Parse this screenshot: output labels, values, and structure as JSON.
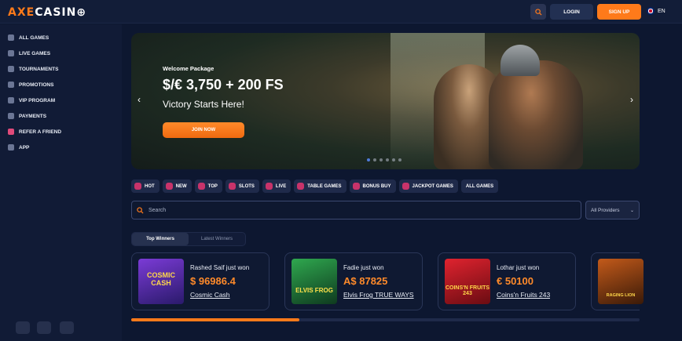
{
  "header": {
    "logo_part1": "AXE",
    "logo_part2": "CASIN⊕",
    "login": "LOGIN",
    "signup": "SIGN UP",
    "lang": "EN"
  },
  "sidebar": {
    "items": [
      {
        "label": "ALL GAMES",
        "icon": "grid-icon"
      },
      {
        "label": "LIVE GAMES",
        "icon": "live-icon"
      },
      {
        "label": "TOURNAMENTS",
        "icon": "trophy-icon"
      },
      {
        "label": "PROMOTIONS",
        "icon": "megaphone-icon"
      },
      {
        "label": "VIP PROGRAM",
        "icon": "crown-icon"
      },
      {
        "label": "PAYMENTS",
        "icon": "wallet-icon"
      },
      {
        "label": "REFER A FRIEND",
        "icon": "friends-icon"
      },
      {
        "label": "APP",
        "icon": "apps-icon"
      }
    ]
  },
  "banner": {
    "welcome": "Welcome Package",
    "amount": "$/€ 3,750 + 200 FS",
    "tagline": "Victory Starts Here!",
    "join": "JOIN NOW",
    "slides": 6,
    "active_slide": 1
  },
  "filters": [
    "HOT",
    "NEW",
    "TOP",
    "SLOTS",
    "LIVE",
    "TABLE GAMES",
    "BONUS BUY",
    "JACKPOT GAMES",
    "ALL GAMES"
  ],
  "search": {
    "placeholder": "Search",
    "providers": "All Providers"
  },
  "tabs": {
    "top": "Top Winners",
    "latest": "Latest Winners"
  },
  "winners": [
    {
      "who": "Rashed Saif just won",
      "amount": "$ 96986.4",
      "game": "Cosmic Cash",
      "thumb": "COSMIC CASH",
      "color": "#5a2fb0"
    },
    {
      "who": "Fadie just won",
      "amount": "A$ 87825",
      "game": "Elvis Frog TRUE WAYS",
      "thumb": "ELVIS FROG",
      "color": "#1f7a3a"
    },
    {
      "who": "Lothar just won",
      "amount": "€ 50100",
      "game": "Coins'n Fruits 243",
      "thumb": "COINS'N FRUITS 243",
      "color": "#b31e2a"
    },
    {
      "who": "",
      "amount": "",
      "game": "",
      "thumb": "RAGING LION",
      "color": "#8a3a12"
    }
  ],
  "carousel_progress": 0.33
}
